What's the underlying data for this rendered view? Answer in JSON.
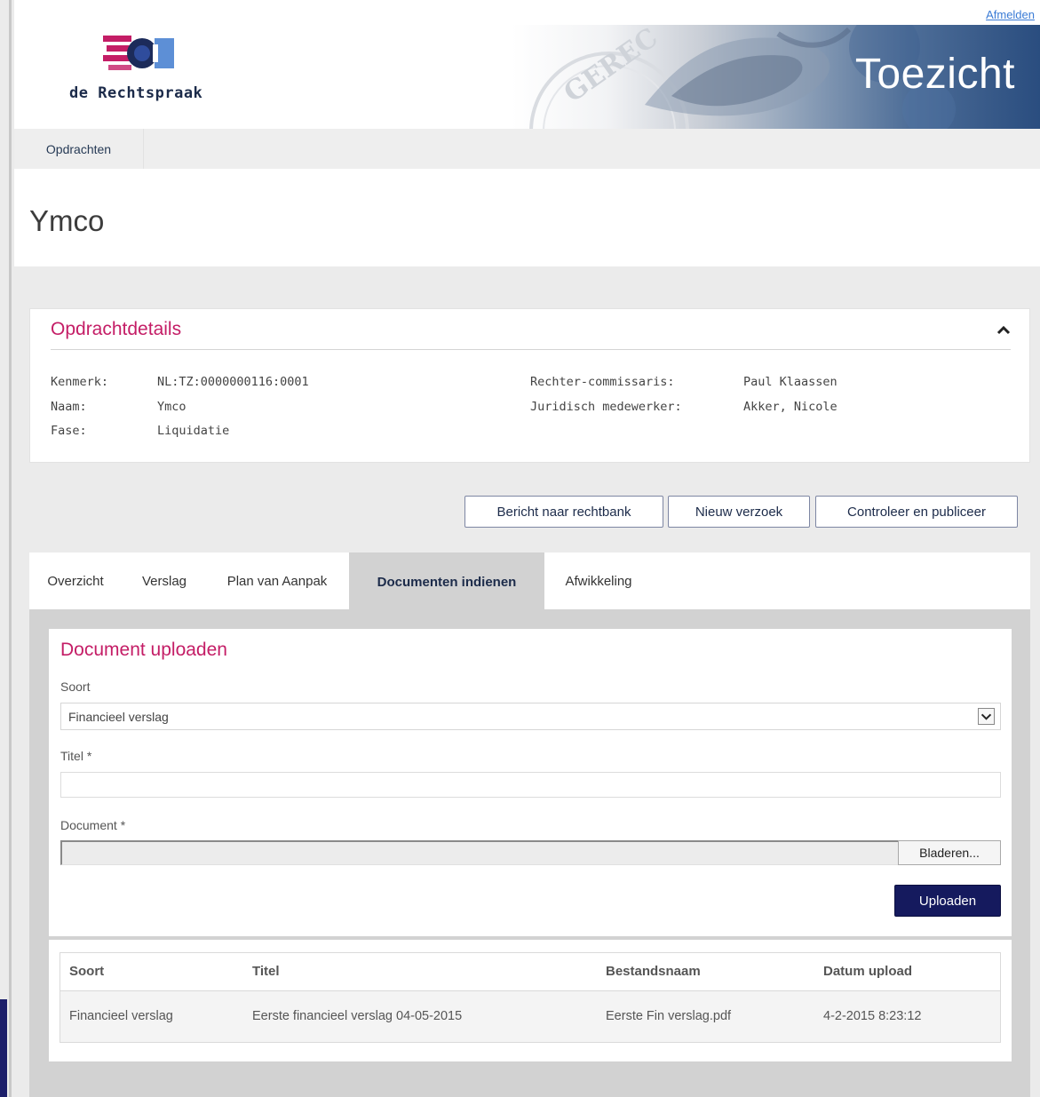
{
  "header": {
    "logo_text": "de Rechtspraak",
    "banner_title": "Toezicht",
    "logout_label": "Afmelden",
    "banner_seal_text": "GEREC"
  },
  "nav": {
    "items": [
      {
        "label": "Opdrachten"
      }
    ]
  },
  "page_title": "Ymco",
  "details_panel": {
    "title": "Opdrachtdetails",
    "left_rows": [
      {
        "label": "Kenmerk:",
        "value": "NL:TZ:0000000116:0001"
      },
      {
        "label": "Naam:",
        "value": "Ymco"
      },
      {
        "label": "Fase:",
        "value": "Liquidatie"
      }
    ],
    "right_rows": [
      {
        "label": "Rechter-commissaris:",
        "value": "Paul Klaassen"
      },
      {
        "label": "Juridisch medewerker:",
        "value": "Akker, Nicole"
      }
    ]
  },
  "actions": {
    "message_label": "Bericht naar rechtbank",
    "new_request_label": "Nieuw verzoek",
    "publish_label": "Controleer en publiceer"
  },
  "tabs": [
    {
      "label": "Overzicht",
      "active": false
    },
    {
      "label": "Verslag",
      "active": false
    },
    {
      "label": "Plan van Aanpak",
      "active": false
    },
    {
      "label": "Documenten indienen",
      "active": true
    },
    {
      "label": "Afwikkeling",
      "active": false
    }
  ],
  "upload_form": {
    "title": "Document uploaden",
    "type_label": "Soort",
    "type_value": "Financieel verslag",
    "title_label": "Titel *",
    "title_value": "",
    "document_label": "Document *",
    "browse_label": "Bladeren...",
    "upload_label": "Uploaden"
  },
  "documents_table": {
    "columns": [
      "Soort",
      "Titel",
      "Bestandsnaam",
      "Datum upload"
    ],
    "rows": [
      [
        "Financieel verslag",
        "Eerste financieel verslag 04-05-2015",
        "Eerste Fin verslag.pdf",
        "4-2-2015 8:23:12"
      ]
    ]
  },
  "colors": {
    "accent_magenta": "#c41d66",
    "primary_navy": "#151a5e",
    "link_blue": "#3a7bd5"
  },
  "icons": {
    "collapse": "chevron-up-icon",
    "select_arrow": "chevron-down-icon"
  }
}
